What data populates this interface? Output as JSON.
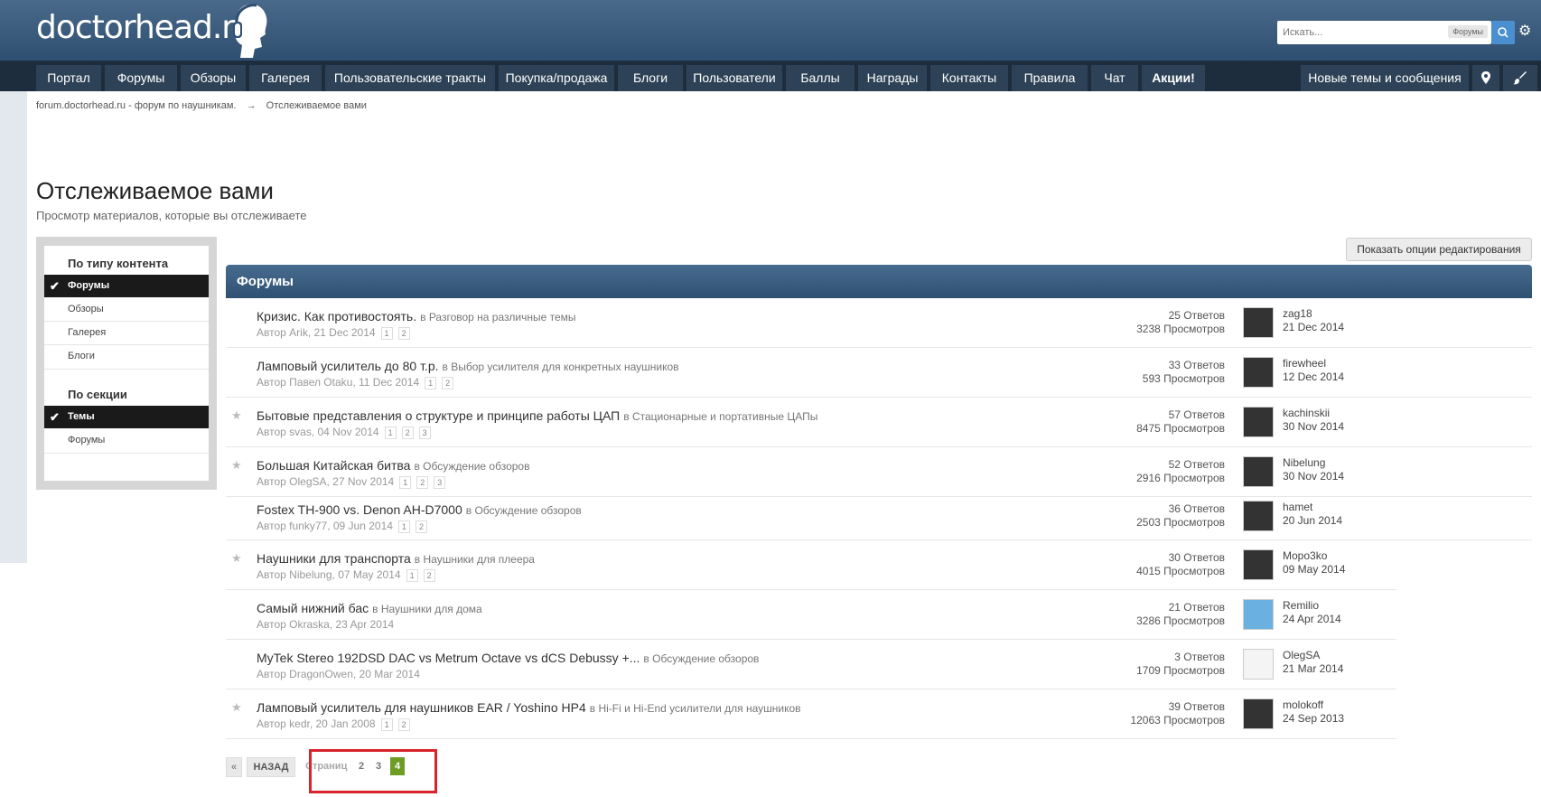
{
  "header": {
    "logo_text": "doctorhead.ru",
    "search_placeholder": "Искать...",
    "search_scope": "Форумы"
  },
  "nav": {
    "items": [
      "Портал",
      "Форумы",
      "Обзоры",
      "Галерея",
      "Пользовательские тракты",
      "Покупка/продажа",
      "Блоги",
      "Пользователи",
      "Баллы",
      "Награды",
      "Контакты",
      "Правила",
      "Чат",
      "Акции!"
    ],
    "new_topics": "Новые темы и сообщения"
  },
  "breadcrumb": {
    "root": "forum.doctorhead.ru - форум по наушникам.",
    "arrow": "→",
    "current": "Отслеживаемое вами"
  },
  "page": {
    "title": "Отслеживаемое вами",
    "subtitle": "Просмотр материалов, которые вы отслеживаете"
  },
  "sidebar": {
    "content_type_header": "По типу контента",
    "content_types": [
      "Форумы",
      "Обзоры",
      "Галерея",
      "Блоги"
    ],
    "section_header": "По секции",
    "sections": [
      "Темы",
      "Форумы"
    ]
  },
  "edit_options_label": "Показать опции редактирования",
  "forum_header": "Форумы",
  "topics": [
    {
      "title": "Кризис. Как противостоять.",
      "section": "в Разговор на различные темы",
      "meta": "Автор Arik, 21 Dec 2014",
      "pages": [
        "1",
        "2"
      ],
      "replies": "25 Ответов",
      "views": "3238 Просмотров",
      "last_user": "zag18",
      "last_date": "21 Dec 2014",
      "starred": false
    },
    {
      "title": "Ламповый усилитель до 80 т.р.",
      "section": "в Выбор усилителя для конкретных наушников",
      "meta": "Автор Павел Otaku, 11 Dec 2014",
      "pages": [
        "1",
        "2"
      ],
      "replies": "33 Ответов",
      "views": "593 Просмотров",
      "last_user": "firewheel",
      "last_date": "12 Dec 2014",
      "starred": false
    },
    {
      "title": "Бытовые представления о структуре и принципе работы ЦАП",
      "section": "в Стационарные и портативные ЦАПы",
      "meta": "Автор svas, 04 Nov 2014",
      "pages": [
        "1",
        "2",
        "3"
      ],
      "replies": "57 Ответов",
      "views": "8475 Просмотров",
      "last_user": "kachinskii",
      "last_date": "30 Nov 2014",
      "starred": true
    },
    {
      "title": "Большая Китайская битва",
      "section": "в Обсуждение обзоров",
      "meta": "Автор OlegSA, 27 Nov 2014",
      "pages": [
        "1",
        "2",
        "3"
      ],
      "replies": "52 Ответов",
      "views": "2916 Просмотров",
      "last_user": "Nibelung",
      "last_date": "30 Nov 2014",
      "starred": true
    },
    {
      "title": "Fostex TH-900 vs. Denon AH-D7000",
      "section": "в Обсуждение обзоров",
      "meta": "Автор funky77, 09 Jun 2014",
      "pages": [
        "1",
        "2"
      ],
      "replies": "36 Ответов",
      "views": "2503 Просмотров",
      "last_user": "hamet",
      "last_date": "20 Jun 2014",
      "starred": false
    },
    {
      "title": "Наушники для транспорта",
      "section": "в Наушники для плеера",
      "meta": "Автор Nibelung, 07 May 2014",
      "pages": [
        "1",
        "2"
      ],
      "replies": "30 Ответов",
      "views": "4015 Просмотров",
      "last_user": "Mopo3ko",
      "last_date": "09 May 2014",
      "starred": true
    },
    {
      "title": "Самый нижний бас",
      "section": "в Наушники для дома",
      "meta": "Автор Okraska, 23 Apr 2014",
      "pages": [],
      "replies": "21 Ответов",
      "views": "3286 Просмотров",
      "last_user": "Remilio",
      "last_date": "24 Apr 2014",
      "starred": false
    },
    {
      "title": "MyTek Stereo 192DSD DAC vs Metrum Octave vs dCS Debussy +...",
      "section": "в Обсуждение обзоров",
      "meta": "Автор DragonOwen, 20 Mar 2014",
      "pages": [],
      "replies": "3 Ответов",
      "views": "1709 Просмотров",
      "last_user": "OlegSA",
      "last_date": "21 Mar 2014",
      "starred": false
    },
    {
      "title": "Ламповый усилитель для наушников EAR / Yoshino HP4",
      "section": "в Hi-Fi и Hi-End усилители для наушников",
      "meta": "Автор kedr, 20 Jan 2008",
      "pages": [
        "1",
        "2"
      ],
      "replies": "39 Ответов",
      "views": "12063 Просмотров",
      "last_user": "molokoff",
      "last_date": "24 Sep 2013",
      "starred": true
    }
  ],
  "pagination": {
    "prev": "«",
    "back": "НАЗАД",
    "label": "Страниц",
    "pages": [
      "2",
      "3"
    ],
    "current": "4"
  }
}
